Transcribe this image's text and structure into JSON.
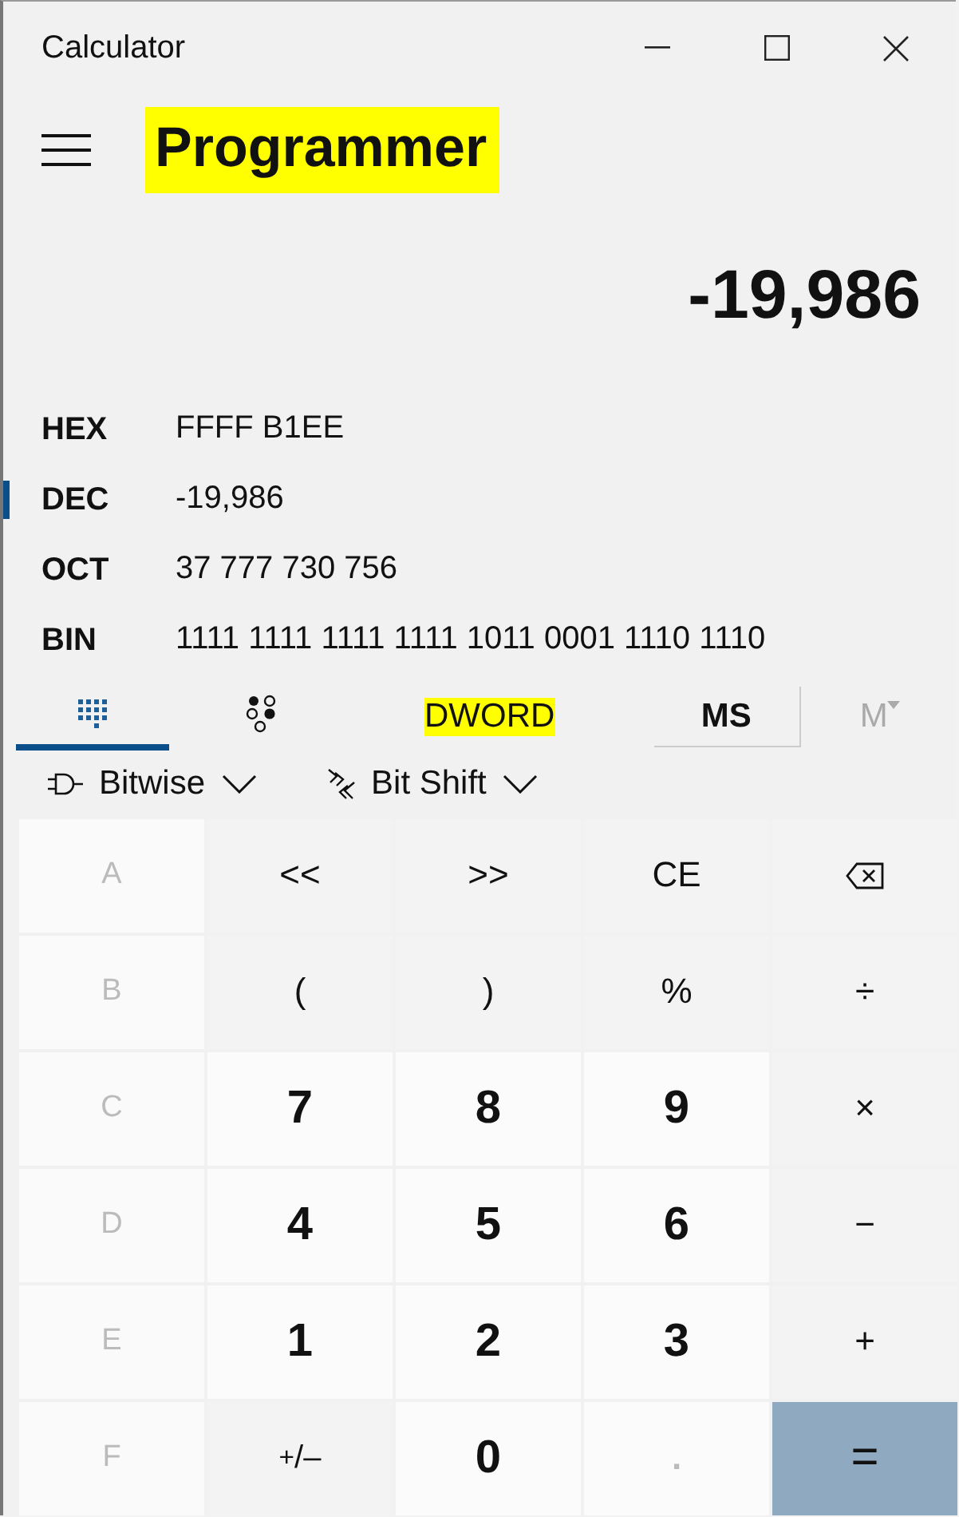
{
  "window": {
    "title": "Calculator"
  },
  "header": {
    "mode": "Programmer",
    "highlighted": true
  },
  "display": {
    "value": "-19,986"
  },
  "radix": [
    {
      "label": "HEX",
      "value": "FFFF B1EE",
      "selected": false
    },
    {
      "label": "DEC",
      "value": "-19,986",
      "selected": true
    },
    {
      "label": "OCT",
      "value": "37 777 730 756",
      "selected": false
    },
    {
      "label": "BIN",
      "value": "1111 1111 1111 1111 1011 0001 1110 1110",
      "selected": false
    }
  ],
  "view_tabs": [
    {
      "kind": "keypad",
      "selected": true
    },
    {
      "kind": "bits",
      "selected": false
    }
  ],
  "word_size": {
    "label": "DWORD",
    "highlighted": true
  },
  "memory": [
    {
      "label": "MS",
      "kind": "store",
      "disabled": false
    },
    {
      "label": "M",
      "kind": "list",
      "disabled": true
    }
  ],
  "menus": [
    {
      "kind": "gate",
      "label": "Bitwise"
    },
    {
      "kind": "shift",
      "label": "Bit Shift"
    }
  ],
  "keys": [
    {
      "label": "A",
      "kind": "hex",
      "disabled": true
    },
    {
      "label": "<<",
      "kind": "op",
      "disabled": false
    },
    {
      "label": ">>",
      "kind": "op",
      "disabled": false
    },
    {
      "label": "CE",
      "kind": "op",
      "disabled": false
    },
    {
      "kind": "backspace",
      "disabled": false
    },
    {
      "label": "B",
      "kind": "hex",
      "disabled": true
    },
    {
      "label": "(",
      "kind": "op",
      "disabled": false
    },
    {
      "label": ")",
      "kind": "op",
      "disabled": false
    },
    {
      "label": "%",
      "kind": "op",
      "disabled": false
    },
    {
      "label": "÷",
      "kind": "op",
      "disabled": false
    },
    {
      "label": "C",
      "kind": "hex",
      "disabled": true
    },
    {
      "label": "7",
      "kind": "digit",
      "disabled": false
    },
    {
      "label": "8",
      "kind": "digit",
      "disabled": false
    },
    {
      "label": "9",
      "kind": "digit",
      "disabled": false
    },
    {
      "label": "×",
      "kind": "op",
      "disabled": false
    },
    {
      "label": "D",
      "kind": "hex",
      "disabled": true
    },
    {
      "label": "4",
      "kind": "digit",
      "disabled": false
    },
    {
      "label": "5",
      "kind": "digit",
      "disabled": false
    },
    {
      "label": "6",
      "kind": "digit",
      "disabled": false
    },
    {
      "label": "−",
      "kind": "op",
      "disabled": false
    },
    {
      "label": "E",
      "kind": "hex",
      "disabled": true
    },
    {
      "label": "1",
      "kind": "digit",
      "disabled": false
    },
    {
      "label": "2",
      "kind": "digit",
      "disabled": false
    },
    {
      "label": "3",
      "kind": "digit",
      "disabled": false
    },
    {
      "label": "+",
      "kind": "op",
      "disabled": false
    },
    {
      "label": "F",
      "kind": "hex",
      "disabled": true
    },
    {
      "label": "$^{+}$/–",
      "kind": "op",
      "disabled": false
    },
    {
      "label": "0",
      "kind": "digit",
      "disabled": false
    },
    {
      "label": ".",
      "kind": "digit",
      "disabled": true
    },
    {
      "label": "=",
      "kind": "equals",
      "disabled": false
    }
  ]
}
